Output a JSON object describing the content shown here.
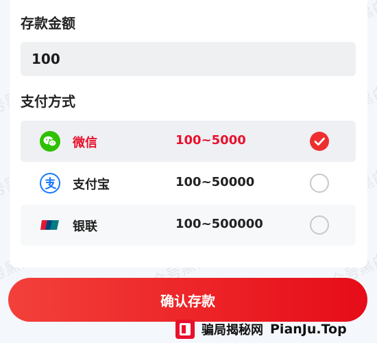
{
  "deposit": {
    "amount_label": "存款金额",
    "amount_value": "100"
  },
  "payment": {
    "method_label": "支付方式",
    "methods": [
      {
        "name": "微信",
        "range": "100~5000",
        "icon": "wechat-icon",
        "selected": true
      },
      {
        "name": "支付宝",
        "range": "100~50000",
        "icon": "alipay-icon",
        "selected": false
      },
      {
        "name": "银联",
        "range": "100~500000",
        "icon": "unionpay-icon",
        "selected": false
      }
    ]
  },
  "confirm_label": "确认存款",
  "watermark_text": "公众号黑白之猫",
  "footer": {
    "brand": "骗局揭秘网",
    "site": "PianJu.Top"
  },
  "colors": {
    "accent": "#e8112d",
    "wechat": "#2dc100",
    "alipay": "#1677ff"
  }
}
